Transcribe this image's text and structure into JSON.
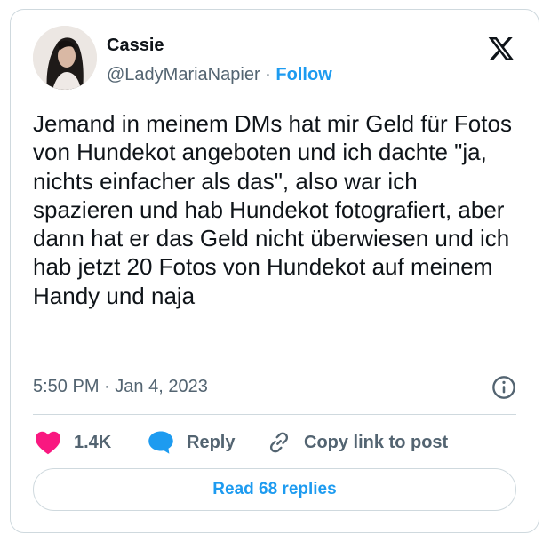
{
  "author": {
    "name": "Cassie",
    "handle": "@LadyMariaNapier",
    "separator": "·",
    "follow_label": "Follow"
  },
  "tweet": {
    "text": "Jemand in meinem DMs hat mir Geld für Fotos von Hundekot angeboten und ich dachte \"ja, nichts einfacher als das\", also war ich spazieren und hab Hundekot fotografiert, aber dann hat er das Geld nicht überwiesen und ich hab jetzt 20 Fotos von Hundekot auf meinem Handy und naja",
    "time": "5:50 PM",
    "date": "Jan 4, 2023",
    "meta_separator": "·"
  },
  "actions": {
    "likes": "1.4K",
    "reply_label": "Reply",
    "copy_label": "Copy link to post",
    "read_replies_label": "Read 68 replies"
  },
  "colors": {
    "accent": "#1d9bf0",
    "like": "#f91880",
    "muted": "#536471"
  },
  "icons": [
    "x-logo-icon",
    "info-icon",
    "heart-icon",
    "speech-bubble-icon",
    "link-icon"
  ]
}
